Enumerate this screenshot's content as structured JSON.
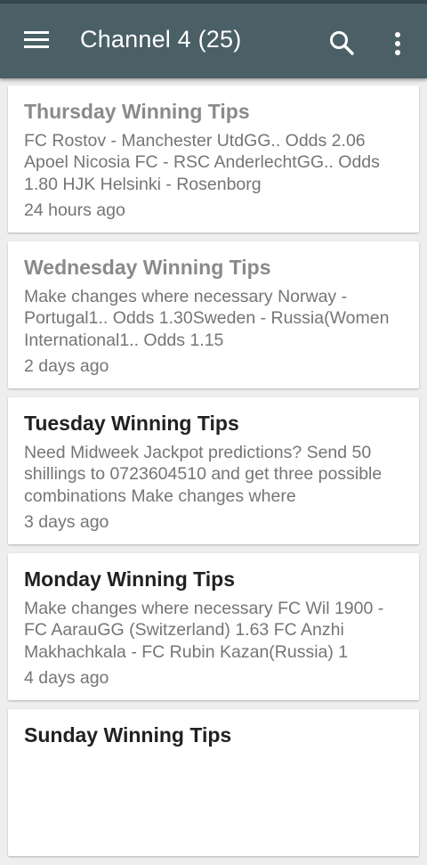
{
  "appbar": {
    "title": "Channel 4 (25)",
    "icons": {
      "menu": "hamburger-menu-icon",
      "search": "search-icon",
      "more": "more-vert-icon"
    }
  },
  "colors": {
    "appbar": "#4a5f66",
    "background": "#eeeeee",
    "title_unread": "#212121",
    "title_read": "#8a8a8a",
    "body_text": "#757575"
  },
  "posts": [
    {
      "title": "Thursday Winning Tips",
      "snippet": "FC Rostov - Manchester UtdGG.. Odds 2.06 Apoel Nicosia FC - RSC AnderlechtGG.. Odds 1.80 HJK Helsinki - Rosenborg",
      "time": "24 hours ago",
      "read": true
    },
    {
      "title": "Wednesday Winning Tips",
      "snippet": "Make changes where necessary Norway - Portugal1.. Odds 1.30Sweden - Russia(Women International1.. Odds 1.15",
      "time": "2 days ago",
      "read": true
    },
    {
      "title": "Tuesday Winning Tips",
      "snippet": "Need Midweek Jackpot predictions? Send 50 shillings to 0723604510 and get three possible combinations Make changes where",
      "time": "3 days ago",
      "read": false
    },
    {
      "title": "Monday Winning Tips",
      "snippet": "Make changes where necessary FC Wil 1900 - FC AarauGG (Switzerland) 1.63 FC Anzhi Makhachkala - FC Rubin Kazan(Russia) 1",
      "time": "4 days ago",
      "read": false
    },
    {
      "title": "Sunday Winning Tips",
      "snippet": "",
      "time": "",
      "read": false
    }
  ]
}
